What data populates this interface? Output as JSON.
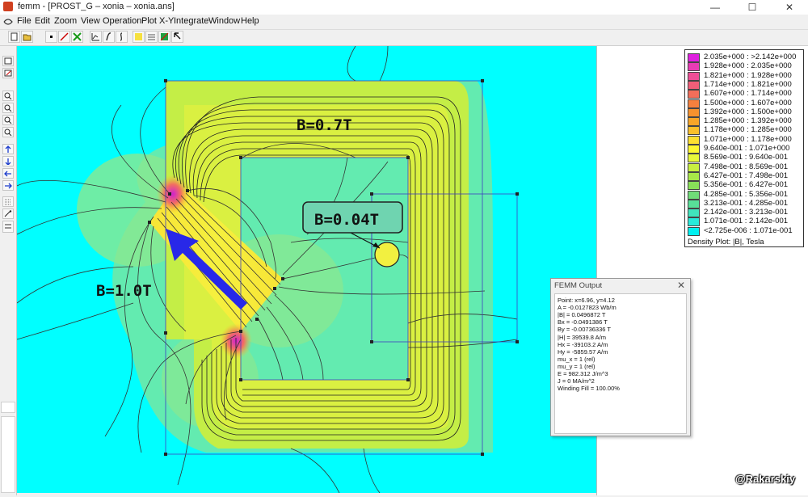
{
  "window": {
    "title": "femm - [PROST_G – xonia – xonia.ans]",
    "minimize": "—",
    "maximize": "☐",
    "close": "✕"
  },
  "menu": [
    "File",
    "Edit",
    "Zoom",
    "View",
    "Operation",
    "Plot X-Y",
    "Integrate",
    "Window",
    "Help"
  ],
  "annotations": {
    "b_top": "B=0.7T",
    "b_left": "B=1.0T",
    "b_center": "B=0.04T"
  },
  "legend": {
    "rows": [
      {
        "label": "2.035e+000 : >2.142e+000",
        "color": "#e020e0"
      },
      {
        "label": "1.928e+000 : 2.035e+000",
        "color": "#e83cb4"
      },
      {
        "label": "1.821e+000 : 1.928e+000",
        "color": "#ee4e96"
      },
      {
        "label": "1.714e+000 : 1.821e+000",
        "color": "#f05e78"
      },
      {
        "label": "1.607e+000 : 1.714e+000",
        "color": "#f26e5a"
      },
      {
        "label": "1.500e+000 : 1.607e+000",
        "color": "#f4803e"
      },
      {
        "label": "1.392e+000 : 1.500e+000",
        "color": "#f6922e"
      },
      {
        "label": "1.285e+000 : 1.392e+000",
        "color": "#f8a628"
      },
      {
        "label": "1.178e+000 : 1.285e+000",
        "color": "#fbc02a"
      },
      {
        "label": "1.071e+000 : 1.178e+000",
        "color": "#fde030"
      },
      {
        "label": "9.640e-001 : 1.071e+000",
        "color": "#fdf830"
      },
      {
        "label": "8.569e-001 : 9.640e-001",
        "color": "#e8f83a"
      },
      {
        "label": "7.498e-001 : 8.569e-001",
        "color": "#c8f040"
      },
      {
        "label": "6.427e-001 : 7.498e-001",
        "color": "#a8e848"
      },
      {
        "label": "5.356e-001 : 6.427e-001",
        "color": "#88e058"
      },
      {
        "label": "4.285e-001 : 5.356e-001",
        "color": "#70dc78"
      },
      {
        "label": "3.213e-001 : 4.285e-001",
        "color": "#58e098"
      },
      {
        "label": "2.142e-001 : 3.213e-001",
        "color": "#40e4bc"
      },
      {
        "label": "1.071e-001 : 2.142e-001",
        "color": "#28eada"
      },
      {
        "label": "<2.725e-006 : 1.071e-001",
        "color": "#00f0f0"
      }
    ],
    "caption": "Density Plot: |B|, Tesla"
  },
  "output": {
    "title": "FEMM Output",
    "close": "✕",
    "lines": [
      "Point: x=6.96, y=4.12",
      "A  = -0.0127823 Wb/m",
      "|B| = 0.0496872 T",
      "Bx  = -0.0491386 T",
      "By  = -0.00736336 T",
      "|H| = 39539.8 A/m",
      "Hx  = -39103.2 A/m",
      "Hy  = -5859.57 A/m",
      "mu_x = 1 (rel)",
      "mu_y = 1 (rel)",
      "E  = 982.312 J/m^3",
      "J  = 0 MA/m^2",
      "Winding Fill = 100.00%"
    ]
  },
  "watermark": "@Rakarskiy",
  "colors": {
    "air": "#00ffff",
    "halo": "#70e6a0",
    "yoke": "#a8ec48",
    "magnet": "#f6ec3c",
    "arrow": "#2828e8"
  },
  "icons": {
    "toolbar": [
      "new-file-icon",
      "open-folder-icon",
      "node-icon",
      "segment-icon",
      "block-label-icon",
      "contour-icon",
      "plot-icon",
      "integrate-icon",
      "density-icon",
      "vector-icon",
      "pointer-icon"
    ],
    "sidebar": [
      "zoom-in-icon",
      "zoom-out-icon",
      "zoom-window-icon",
      "zoom-natural-icon",
      "pan-up-icon",
      "pan-down-icon",
      "pan-left-icon",
      "pan-right-icon",
      "grid-icon",
      "snap-icon"
    ]
  }
}
